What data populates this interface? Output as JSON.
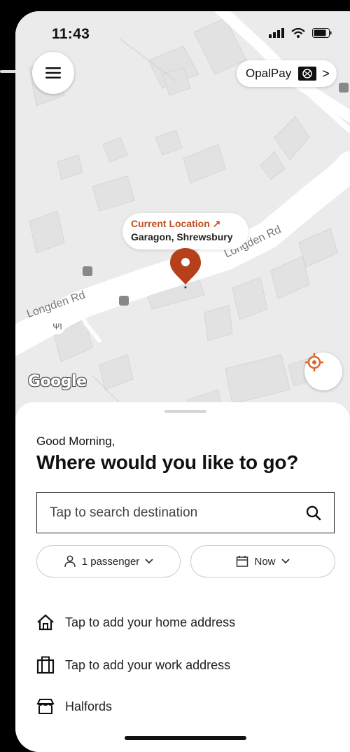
{
  "status_bar": {
    "time": "11:43"
  },
  "header": {
    "menu_icon": "hamburger-icon",
    "opal_label": "OpalPay",
    "opal_chevron": ">"
  },
  "map": {
    "road_name_1": "Longden Rd",
    "road_name_2": "Longden Rd",
    "current_location_label": "Current Location ↗",
    "current_location_place": "Garagon, Shrewsbury",
    "attribution": "Google",
    "locate_icon": "crosshair-icon"
  },
  "sheet": {
    "greeting": "Good Morning,",
    "headline": "Where would you like to go?",
    "search_placeholder": "Tap to search destination",
    "passenger_chip": "1 passenger",
    "time_chip": "Now",
    "home_row": "Tap to add your home address",
    "work_row": "Tap to add your work address",
    "recent_row": "Halfords"
  },
  "colors": {
    "accent": "#c0501f",
    "pin": "#b5401a",
    "locate": "#e0642a"
  }
}
